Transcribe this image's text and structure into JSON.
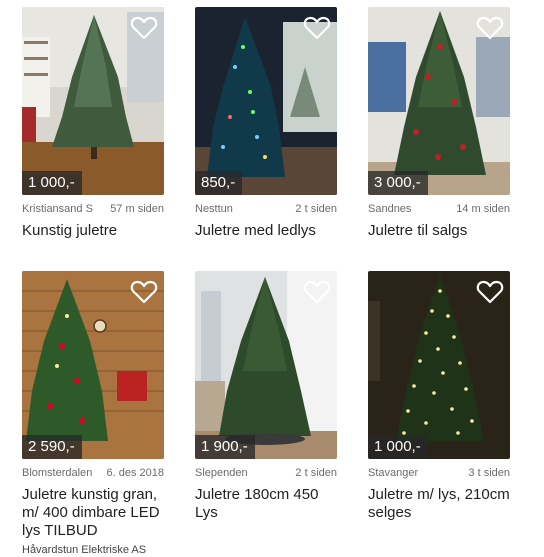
{
  "listings": [
    {
      "price": "1 000,-",
      "location": "Kristiansand S",
      "time": "57 m siden",
      "title": "Kunstig juletre",
      "seller": ""
    },
    {
      "price": "850,-",
      "location": "Nesttun",
      "time": "2 t siden",
      "title": "Juletre med ledlys",
      "seller": ""
    },
    {
      "price": "3 000,-",
      "location": "Sandnes",
      "time": "14 m siden",
      "title": "Juletre til salgs",
      "seller": ""
    },
    {
      "price": "2 590,-",
      "location": "Blomsterdalen",
      "time": "6. des 2018",
      "title": "Juletre kunstig gran, m/ 400 dimbare LED lys TILBUD",
      "seller": "Håvardstun Elektriske AS"
    },
    {
      "price": "1 900,-",
      "location": "Slependen",
      "time": "2 t siden",
      "title": "Juletre 180cm 450 Lys",
      "seller": ""
    },
    {
      "price": "1 000,-",
      "location": "Stavanger",
      "time": "3 t siden",
      "title": "Juletre m/ lys, 210cm selges",
      "seller": ""
    }
  ],
  "icons": {
    "favorite": "heart-outline-icon"
  },
  "colors": {
    "price_badge_bg": "#282828",
    "meta_text": "#6b6b6b",
    "title_text": "#222222"
  }
}
